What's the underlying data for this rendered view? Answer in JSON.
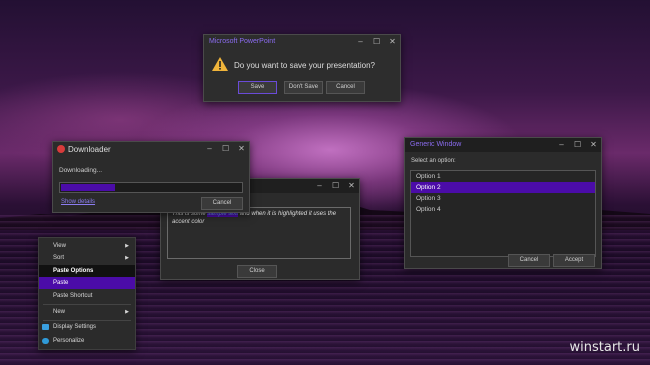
{
  "colors": {
    "accent": "#4b0ca8",
    "title_accent": "#8b6cf0",
    "window_bg": "#2b2b2b"
  },
  "ppt": {
    "title": "Microsoft PowerPoint",
    "message": "Do you want to save your presentation?",
    "icon": "warning-icon",
    "buttons": {
      "save": "Save",
      "dont_save": "Don't Save",
      "cancel": "Cancel"
    }
  },
  "generic": {
    "title": "Generic Window",
    "prompt": "Select an option:",
    "options": [
      "Option 1",
      "Option 2",
      "Option 3",
      "Option 4"
    ],
    "selected": "Option 2",
    "buttons": {
      "cancel": "Cancel",
      "accept": "Accept"
    }
  },
  "sample": {
    "text_before": "This is some ",
    "text_highlight": "sample text",
    "text_after": " and when it is highlighted it uses the accent color",
    "close_label": "Close"
  },
  "downloader": {
    "title": "Downloader",
    "status": "Downloading...",
    "progress_fraction": 0.3,
    "link": "Show details",
    "cancel": "Cancel"
  },
  "menu": {
    "view": "View",
    "sort": "Sort",
    "paste_options": "Paste Options",
    "paste": "Paste",
    "paste_shortcut": "Paste Shortcut",
    "new": "New",
    "display_settings": "Display Settings",
    "personalize": "Personalize"
  },
  "watermark": "winstart.ru"
}
